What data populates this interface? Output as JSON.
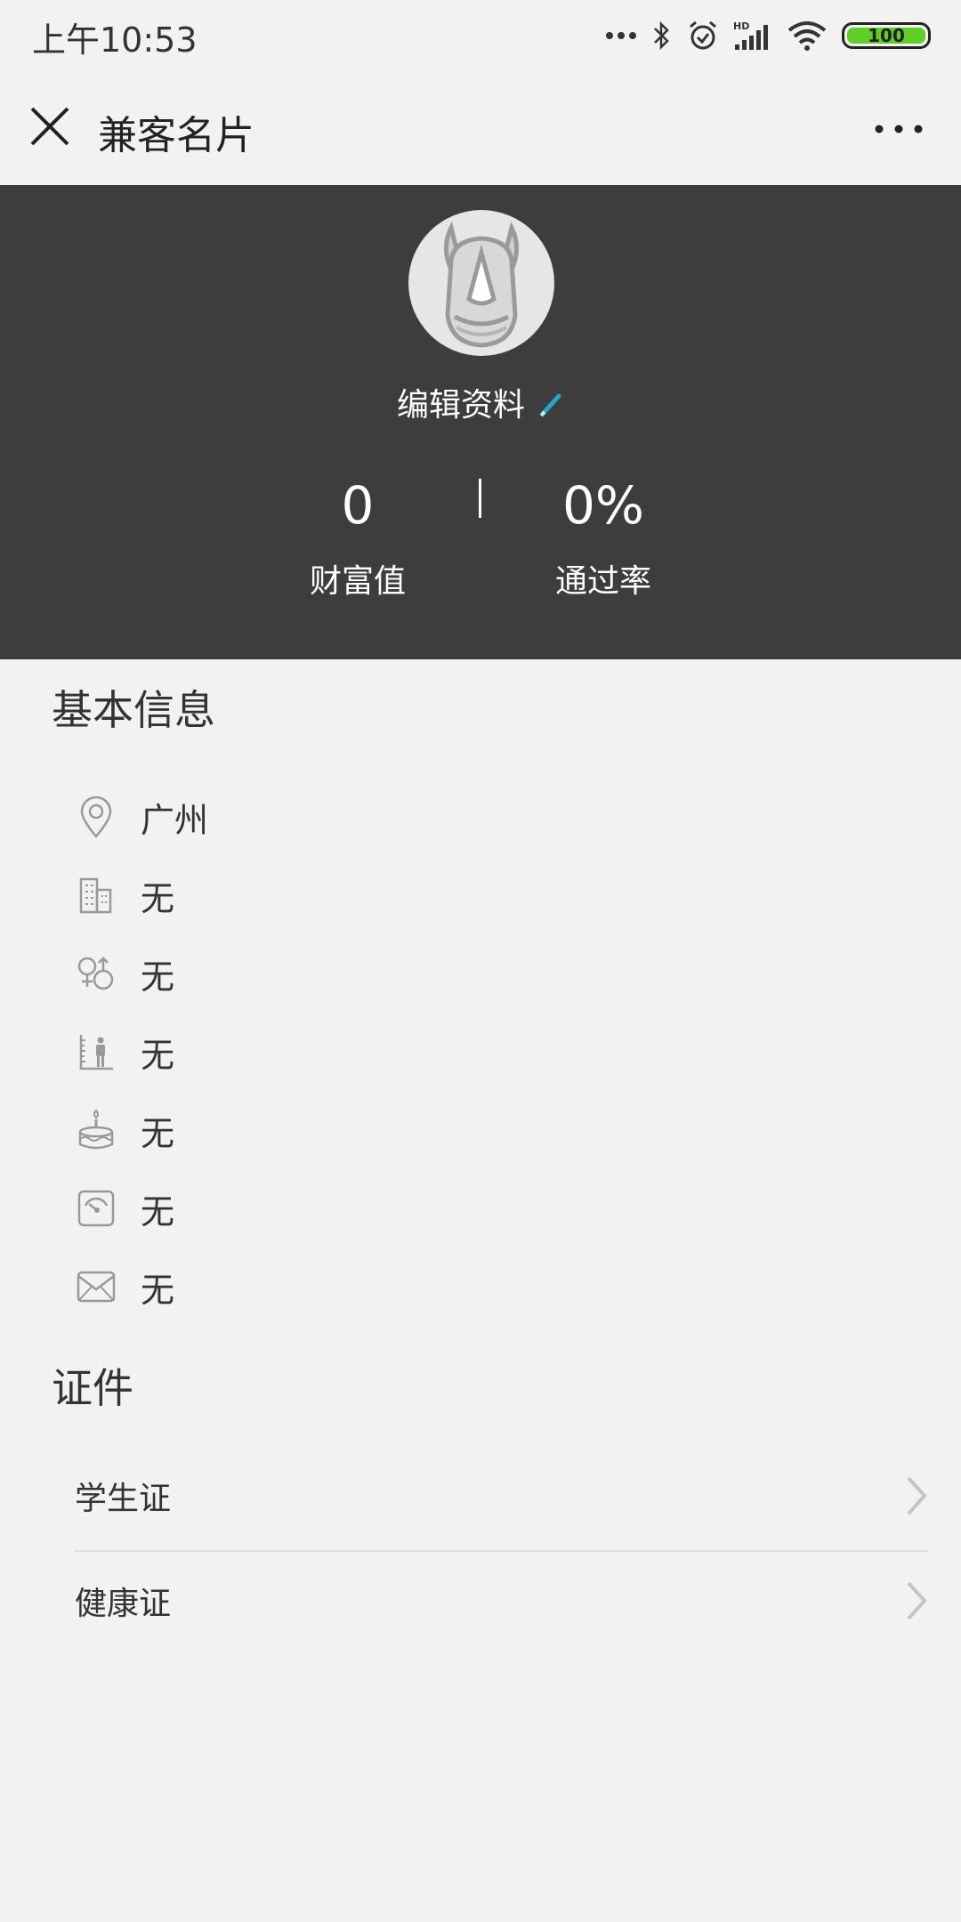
{
  "status_bar": {
    "time": "上午10:53",
    "battery": "100"
  },
  "nav": {
    "title": "兼客名片"
  },
  "profile": {
    "edit_label": "编辑资料",
    "stats": [
      {
        "value": "0",
        "label": "财富值"
      },
      {
        "value": "0%",
        "label": "通过率"
      }
    ]
  },
  "basic_info": {
    "title": "基本信息",
    "items": [
      {
        "icon": "location-icon",
        "value": "广州"
      },
      {
        "icon": "building-icon",
        "value": "无"
      },
      {
        "icon": "gender-icon",
        "value": "无"
      },
      {
        "icon": "height-icon",
        "value": "无"
      },
      {
        "icon": "birthday-cake-icon",
        "value": "无"
      },
      {
        "icon": "weight-scale-icon",
        "value": "无"
      },
      {
        "icon": "mail-icon",
        "value": "无"
      }
    ]
  },
  "certificates": {
    "title": "证件",
    "items": [
      {
        "label": "学生证"
      },
      {
        "label": "健康证"
      }
    ]
  },
  "colors": {
    "panel_bg": "#3d3d3d",
    "page_bg": "#f2f2f2",
    "battery": "#5fce2a",
    "pencil_accent": "#27a7c8"
  }
}
